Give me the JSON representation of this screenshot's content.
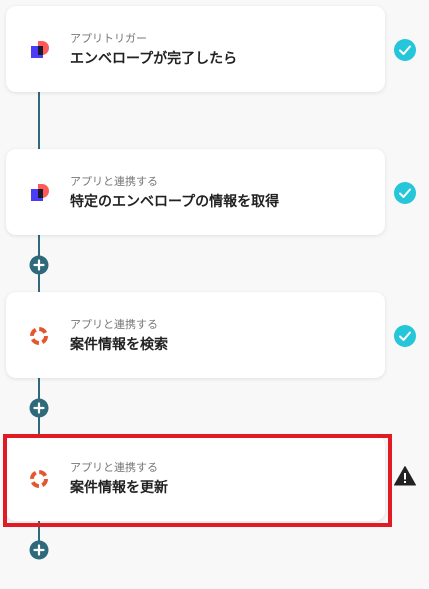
{
  "steps": [
    {
      "label": "アプリトリガー",
      "title": "エンベロープが完了したら",
      "app_icon": "docusign-icon",
      "status": "check-icon"
    },
    {
      "label": "アプリと連携する",
      "title": "特定のエンベロープの情報を取得",
      "app_icon": "docusign-icon",
      "status": "check-icon"
    },
    {
      "label": "アプリと連携する",
      "title": "案件情報を検索",
      "app_icon": "lifebuoy-ring-icon",
      "status": "check-icon"
    },
    {
      "label": "アプリと連携する",
      "title": "案件情報を更新",
      "app_icon": "lifebuoy-ring-icon",
      "status": "warning-icon"
    }
  ],
  "add_button_icon": "plus-icon",
  "colors": {
    "background": "#f8f8f8",
    "connector": "#2f6a7c",
    "check": "#26c6da",
    "warning": "#222222",
    "highlight": "#e01b24",
    "docusign_red": "#ff5a5a",
    "docusign_purple": "#4b3df5",
    "ring_orange": "#e4572e"
  }
}
